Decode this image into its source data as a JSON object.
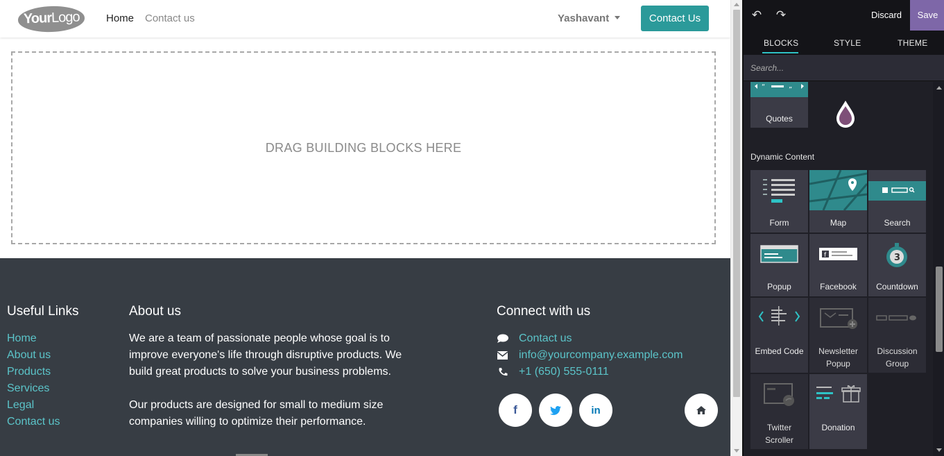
{
  "header": {
    "logo_bold": "Your",
    "logo_light": "Logo",
    "nav": [
      {
        "label": "Home"
      },
      {
        "label": "Contact us"
      }
    ],
    "user": "Yashavant",
    "cta": "Contact Us"
  },
  "dropzone": {
    "message": "DRAG BUILDING BLOCKS HERE"
  },
  "footer": {
    "useful_links_title": "Useful Links",
    "useful_links": [
      "Home",
      "About us",
      "Products",
      "Services",
      "Legal",
      "Contact us"
    ],
    "about_title": "About us",
    "about_p1": "We are a team of passionate people whose goal is to improve everyone's life through disruptive products. We build great products to solve your business problems.",
    "about_p2": "Our products are designed for small to medium size companies willing to optimize their performance.",
    "connect_title": "Connect with us",
    "connect": [
      {
        "icon": "comment-icon",
        "label": "Contact us"
      },
      {
        "icon": "envelope-icon",
        "label": "info@yourcompany.example.com"
      },
      {
        "icon": "phone-icon",
        "label": "+1 (650) 555-0111"
      }
    ],
    "social": [
      {
        "icon": "facebook-icon",
        "glyph": "f",
        "color": "#3b5998"
      },
      {
        "icon": "twitter-icon",
        "glyph": "t",
        "color": "#1da1f2"
      },
      {
        "icon": "linkedin-icon",
        "glyph": "in",
        "color": "#0077b5"
      },
      {
        "icon": "home-icon",
        "glyph": "⌂",
        "color": "#373d44"
      }
    ]
  },
  "editor": {
    "discard": "Discard",
    "save": "Save",
    "tabs": [
      "BLOCKS",
      "STYLE",
      "THEME"
    ],
    "search_placeholder": "Search...",
    "category": "Dynamic Content",
    "blocks": {
      "quotes": "Quotes",
      "form": "Form",
      "map": "Map",
      "search": "Search",
      "popup": "Popup",
      "facebook": "Facebook",
      "countdown": "Countdown",
      "embed": "Embed Code",
      "newsletter1": "Newsletter",
      "newsletter2": "Popup",
      "discussion1": "Discussion",
      "discussion2": "Group",
      "twitter1": "Twitter",
      "twitter2": "Scroller",
      "donation": "Donation"
    },
    "countdown_number": "3",
    "accent": "#2ec2c5",
    "save_color": "#7e67a8"
  }
}
